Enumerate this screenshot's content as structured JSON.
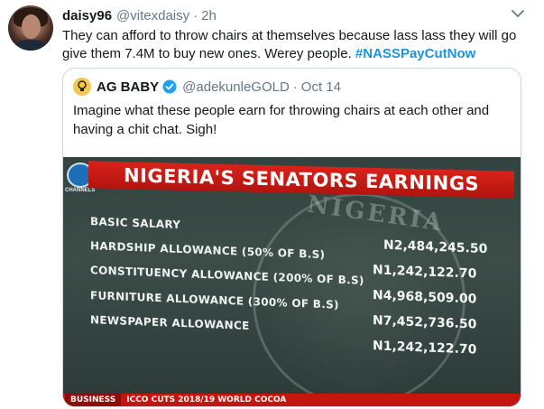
{
  "tweet": {
    "author_name": "daisy96",
    "author_handle": "@vitexdaisy",
    "separator": "·",
    "time": "2h",
    "text": "They can afford to throw chairs at themselves because lass lass they will go give them 7.4M to buy new ones. Werey people.",
    "hashtag": "#NASSPayCutNow"
  },
  "quote": {
    "author_name": "AG BABY",
    "author_handle": "@adekunleGOLD",
    "separator": "·",
    "date": "Oct 14",
    "text": "Imagine what these people earn for throwing chairs at each other and having a chit chat. Sigh!"
  },
  "photo": {
    "channel_logo_text": "CHANNELS",
    "banner_title": "NIGERIA'S SENATORS EARNINGS",
    "seal_text": "NIGERIA",
    "rows": [
      {
        "label": "BASIC SALARY",
        "amount": "N2,484,245.50"
      },
      {
        "label": "HARDSHIP ALLOWANCE (50% OF B.S)",
        "amount": "N1,242,122.70"
      },
      {
        "label": "CONSTITUENCY ALLOWANCE (200% OF B.S)",
        "amount": "N4,968,509.00"
      },
      {
        "label": "FURNITURE ALLOWANCE (300% OF B.S)",
        "amount": "N7,452,736.50"
      },
      {
        "label": "NEWSPAPER ALLOWANCE",
        "amount": "N1,242,122.70"
      }
    ],
    "ticker_section": "BUSINESS",
    "ticker_text": "ICCO CUTS 2018/19 WORLD COCOA"
  },
  "colors": {
    "hashtag": "#1b95e0",
    "banner": "#d9221a",
    "verified": "#1da1f2"
  },
  "icons": {
    "caret": "chevron-down-icon",
    "verified": "verified-badge-icon",
    "quote_avatar": "lightbulb-icon"
  }
}
